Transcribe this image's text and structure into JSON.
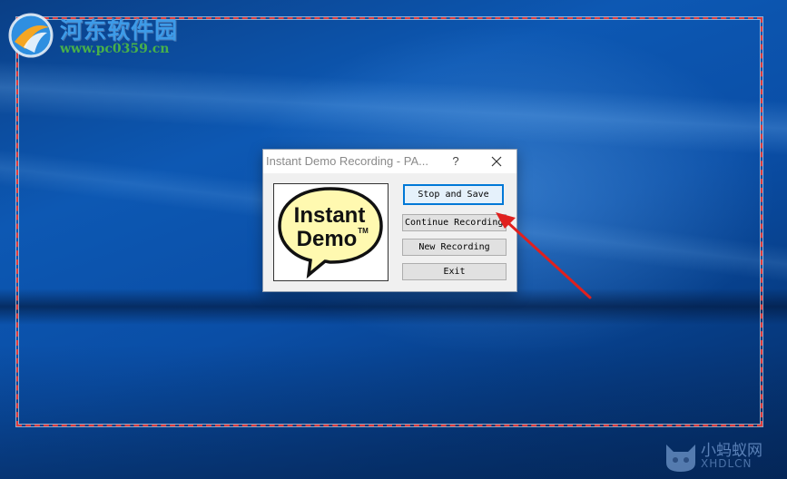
{
  "watermark": {
    "title": "河东软件园",
    "url": "www.pc0359.cn"
  },
  "watermark2": {
    "title": "小蚂蚁网",
    "url": "XHDLCN"
  },
  "dialog": {
    "title": "Instant Demo Recording - PA...",
    "help_label": "?",
    "logo_text_line1": "Instant",
    "logo_text_line2": "Demo",
    "logo_tm": "TM",
    "buttons": {
      "stop_and_save": "Stop and Save",
      "continue_recording": "Continue Recording",
      "new_recording": "New Recording",
      "exit": "Exit"
    }
  },
  "colors": {
    "capture_frame": "#e23b3b",
    "annotation_arrow": "#e0201e",
    "focus_border": "#0078d7",
    "bubble_fill": "#fff9b0"
  }
}
